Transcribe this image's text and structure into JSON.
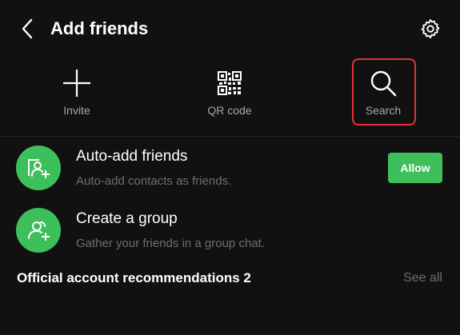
{
  "header": {
    "title": "Add friends",
    "back_icon": "chevron-left-icon",
    "settings_icon": "gear-icon"
  },
  "actions": [
    {
      "label": "Invite",
      "icon": "plus-icon"
    },
    {
      "label": "QR code",
      "icon": "qr-code-icon"
    },
    {
      "label": "Search",
      "icon": "search-icon"
    }
  ],
  "rows": [
    {
      "title": "Auto-add friends",
      "subtitle": "Auto-add contacts as friends.",
      "icon": "contact-add-icon",
      "button_label": "Allow"
    },
    {
      "title": "Create a group",
      "subtitle": "Gather your friends in a group chat.",
      "icon": "group-add-icon"
    }
  ],
  "section": {
    "title": "Official account recommendations 2",
    "see_all": "See all"
  },
  "colors": {
    "background": "#111111",
    "accent": "#3dbf5c",
    "highlight": "#e5303c",
    "muted_text": "#6e6e6e"
  }
}
